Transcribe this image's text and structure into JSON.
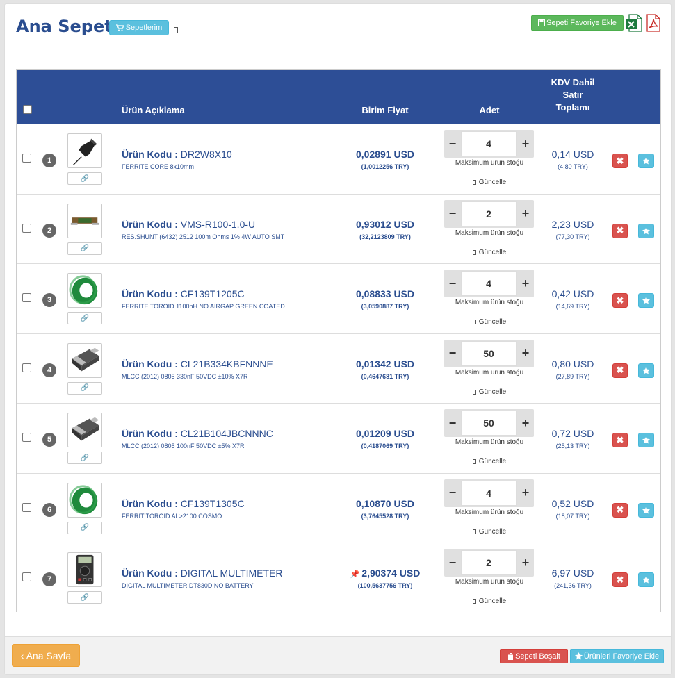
{
  "header": {
    "title": "Ana Sepet",
    "my_carts_label": "Sepetlerim",
    "add_cart_favorite_label": "Sepeti Favoriye Ekle"
  },
  "table": {
    "headers": {
      "description": "Ürün Açıklama",
      "unit_price": "Birim Fiyat",
      "quantity": "Adet",
      "total_line1": "KDV Dahil",
      "total_line2": "Satır",
      "total_line3": "Toplamı"
    },
    "code_label": "Ürün Kodu :",
    "stock_label": "Maksimum ürün stoğu",
    "update_label": "Güncelle",
    "rows": [
      {
        "num": "1",
        "code": "DR2W8X10",
        "desc": "FERRITE CORE 8x10mm",
        "price": "0,02891 USD",
        "price_try": "(1,0012256 TRY)",
        "qty": "4",
        "total": "0,14 USD",
        "total_try": "(4,80 TRY)",
        "thumb": "pushpin",
        "price_flag": ""
      },
      {
        "num": "2",
        "code": "VMS-R100-1.0-U",
        "desc": "RES.SHUNT (6432) 2512 100m Ohms 1% 4W AUTO SMT",
        "price": "0,93012 USD",
        "price_try": "(32,2123809 TRY)",
        "qty": "2",
        "total": "2,23 USD",
        "total_try": "(77,30 TRY)",
        "thumb": "shunt",
        "price_flag": ""
      },
      {
        "num": "3",
        "code": "CF139T1205C",
        "desc": "FERRITE TOROID 1100nH NO AIRGAP GREEN COATED",
        "price": "0,08833 USD",
        "price_try": "(3,0590887 TRY)",
        "qty": "4",
        "total": "0,42 USD",
        "total_try": "(14,69 TRY)",
        "thumb": "toroid",
        "price_flag": ""
      },
      {
        "num": "4",
        "code": "CL21B334KBFNNNE",
        "desc": "MLCC (2012) 0805 330nF 50VDC ±10% X7R",
        "price": "0,01342 USD",
        "price_try": "(0,4647681 TRY)",
        "qty": "50",
        "total": "0,80 USD",
        "total_try": "(27,89 TRY)",
        "thumb": "chip",
        "price_flag": ""
      },
      {
        "num": "5",
        "code": "CL21B104JBCNNNC",
        "desc": "MLCC (2012) 0805 100nF 50VDC ±5% X7R",
        "price": "0,01209 USD",
        "price_try": "(0,4187069 TRY)",
        "qty": "50",
        "total": "0,72 USD",
        "total_try": "(25,13 TRY)",
        "thumb": "chip",
        "price_flag": ""
      },
      {
        "num": "6",
        "code": "CF139T1305C",
        "desc": "FERRIT TOROID AL>2100 COSMO",
        "price": "0,10870 USD",
        "price_try": "(3,7645528 TRY)",
        "qty": "4",
        "total": "0,52 USD",
        "total_try": "(18,07 TRY)",
        "thumb": "toroid",
        "price_flag": ""
      },
      {
        "num": "7",
        "code": "DIGITAL MULTIMETER",
        "desc": "DIGITAL MULTIMETER DT830D NO BATTERY",
        "price": "2,90374 USD",
        "price_try": "(100,5637756 TRY)",
        "qty": "2",
        "total": "6,97 USD",
        "total_try": "(241,36 TRY)",
        "thumb": "multimeter",
        "price_flag": "pin-icon"
      }
    ]
  },
  "footer": {
    "home_label": "‹ Ana Sayfa",
    "empty_cart_label": "Sepeti Boşalt",
    "add_all_favorite_label": "Ürünleri Favoriye Ekle"
  },
  "colors": {
    "header_bg": "#2d4e96",
    "text_blue": "#2a4d8f",
    "danger": "#d9534f",
    "info": "#5bc0de",
    "success": "#5cb85c",
    "warning": "#f0ad4e"
  }
}
